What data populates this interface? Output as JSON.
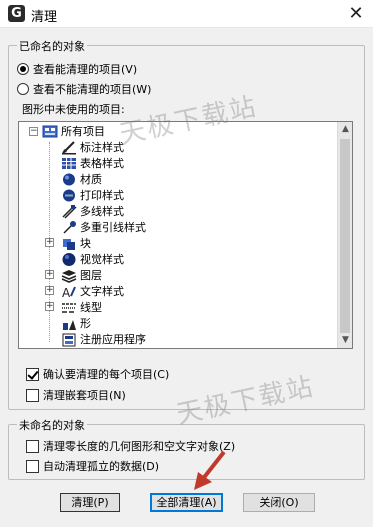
{
  "window": {
    "title": "清理",
    "app_icon_letter": "G",
    "close_glyph": "✕"
  },
  "named_group": {
    "label": "已命名的对象",
    "radio_purgeable": "查看能清理的项目(V)",
    "radio_nonpurgeable": "查看不能清理的项目(W)",
    "tree_label": "图形中未使用的项目:"
  },
  "tree": {
    "root": "所有项目",
    "items": [
      {
        "label": "标注样式",
        "icon": "dimension-style-icon",
        "expandable": false
      },
      {
        "label": "表格样式",
        "icon": "table-style-icon",
        "expandable": false
      },
      {
        "label": "材质",
        "icon": "material-icon",
        "expandable": false
      },
      {
        "label": "打印样式",
        "icon": "plot-style-icon",
        "expandable": false
      },
      {
        "label": "多线样式",
        "icon": "multiline-style-icon",
        "expandable": false
      },
      {
        "label": "多重引线样式",
        "icon": "multileader-style-icon",
        "expandable": false
      },
      {
        "label": "块",
        "icon": "block-icon",
        "expandable": true
      },
      {
        "label": "视觉样式",
        "icon": "visual-style-icon",
        "expandable": false
      },
      {
        "label": "图层",
        "icon": "layer-icon",
        "expandable": true
      },
      {
        "label": "文字样式",
        "icon": "text-style-icon",
        "expandable": true
      },
      {
        "label": "线型",
        "icon": "linetype-icon",
        "expandable": true
      },
      {
        "label": "形",
        "icon": "shape-icon",
        "expandable": false
      },
      {
        "label": "注册应用程序",
        "icon": "regapp-icon",
        "expandable": false
      }
    ]
  },
  "options": {
    "confirm_each": "确认要清理的每个项目(C)",
    "confirm_each_checked": true,
    "nested": "清理嵌套项目(N)",
    "nested_checked": false
  },
  "unnamed_group": {
    "label": "未命名的对象",
    "zero_length": "清理零长度的几何图形和空文字对象(Z)",
    "orphan_data": "自动清理孤立的数据(D)"
  },
  "buttons": {
    "purge": "清理(P)",
    "purge_all": "全部清理(A)",
    "close": "关闭(O)"
  },
  "watermark": "天极下载站",
  "colors": {
    "accent": "#0078d7",
    "arrow": "#c0392b"
  }
}
